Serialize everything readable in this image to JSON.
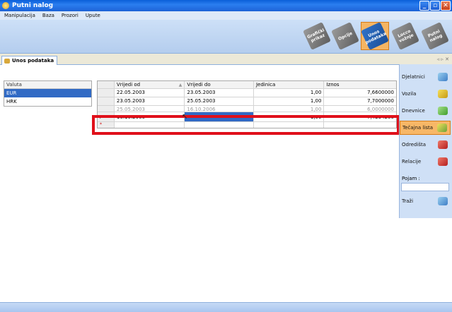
{
  "window": {
    "title": "Putni nalog"
  },
  "menu": [
    "Manipulacija",
    "Baza",
    "Prozori",
    "Upute"
  ],
  "toolbar": [
    {
      "label": "Grafički prikaz",
      "active": false
    },
    {
      "label": "Opcije",
      "active": false
    },
    {
      "label": "Unos podataka",
      "active": true
    },
    {
      "label": "Locco vožnje",
      "active": false
    },
    {
      "label": "Putni nalog",
      "active": false
    }
  ],
  "doc_tab": {
    "label": "Unos podataka"
  },
  "valuta": {
    "header": "Valuta",
    "rows": [
      "EUR",
      "HRK"
    ],
    "selected": "EUR"
  },
  "grid": {
    "columns": [
      "Vrijedi od",
      "Vrijedi do",
      "Jedinica",
      "Iznos"
    ],
    "rows": [
      {
        "od": "22.05.2003",
        "do": "23.05.2003",
        "jedinica": "1,00",
        "iznos": "7,6600000"
      },
      {
        "od": "23.05.2003",
        "do": "25.05.2003",
        "jedinica": "1,00",
        "iznos": "7,7000000"
      },
      {
        "od": "25.05.2003",
        "do": "16.10.2006",
        "jedinica": "1,00",
        "iznos": "6,0000000"
      },
      {
        "od": "16.10.2006",
        "do": "",
        "jedinica": "1,00",
        "iznos": "7,4234200"
      }
    ]
  },
  "side_panel": {
    "items": [
      {
        "label": "Djelatnici"
      },
      {
        "label": "Vozila"
      },
      {
        "label": "Dnevnice"
      },
      {
        "label": "Tečajna lista"
      },
      {
        "label": "Odredišta"
      },
      {
        "label": "Relacije"
      }
    ],
    "active": "Tečajna lista",
    "search_label": "Pojam :",
    "search_button": "Traži"
  }
}
